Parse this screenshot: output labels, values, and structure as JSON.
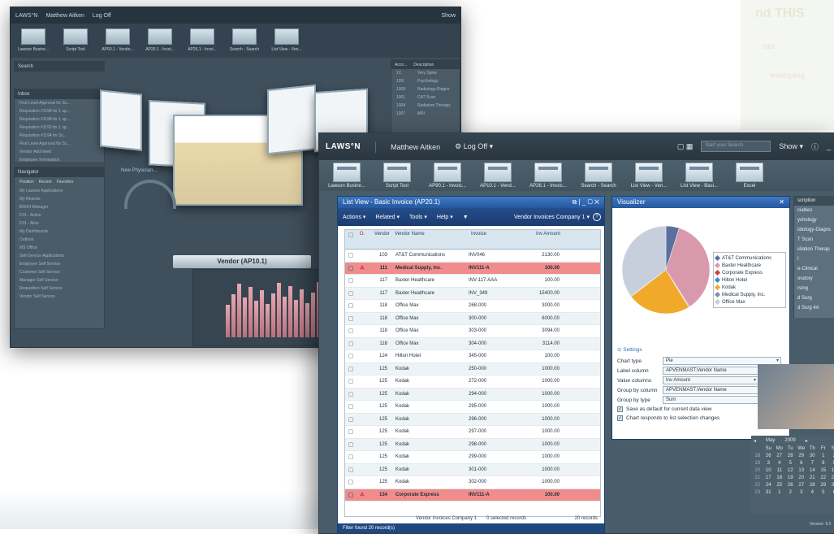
{
  "background_app": {
    "logo": "LAWS°N",
    "user": "Matthew Aitken",
    "logoff": "Log Off",
    "show": "Show",
    "thumbs": [
      "Lawson Busine...",
      "Script Tool",
      "AP90.1 - Vendo...",
      "AP20.1 - Invoi...",
      "AP26.1 - Invoi...",
      "Search - Search",
      "List View - Ven..."
    ],
    "search_header": "Search",
    "inbox_header": "Inbox",
    "inbox_items": [
      "First Level Approval for Sc...",
      "Requisition #1198 for 1 sp...",
      "Requisition #1198 for 1 sp...",
      "Requisition #1193 for 1 sp...",
      "Requisition #1194 for Sc...",
      "First Level Approval for Sc...",
      "Vendor Add Need",
      "Employee Termination"
    ],
    "navigator_header": "Navigator",
    "navigator_tabs": [
      "Position",
      "Recent",
      "Favorites"
    ],
    "navigator_items": [
      "My Lawson Applications",
      "My Reports",
      "BWJH Manager",
      "D11 - Active",
      "D11 - Alice",
      "My Dashboards",
      "Outlook",
      "MS Office",
      "Self-Service Applications",
      "Employee Self Service",
      "Customer Self Service",
      "Manager Self Service",
      "Requisition Self Service",
      "Vendor Self Service"
    ],
    "desc_columns": [
      "Acco...",
      "Description"
    ],
    "desc_rows": [
      [
        "1C",
        "Very Spine"
      ],
      [
        "1D6",
        "Psychology"
      ],
      [
        "1009",
        "Radiology-Diagns"
      ],
      [
        "1001",
        "CAT Scan"
      ],
      [
        "1004",
        "Radiation Therapy"
      ],
      [
        "1007",
        "MRI"
      ]
    ],
    "vendor_banner": "Vendor (AP10.1)",
    "gauge_label": "New Physician..."
  },
  "titlebar": {
    "logo": "LAWS°N",
    "user": "Matthew Aitken",
    "logoff": "Log Off",
    "search_placeholder": "Start your Search",
    "show": "Show"
  },
  "thumbs": [
    "Lawson Busine...",
    "Script Tool",
    "AP90.1 - Invoic...",
    "AP10.1 - Vend...",
    "AP26.1 - Invoic...",
    "Search - Search",
    "List View - Ven...",
    "List View - Basi...",
    "Excel"
  ],
  "listview": {
    "title": "List View - Basic Invoice (AP20.1)",
    "menu": [
      "Actions",
      "Related",
      "Tools",
      "Help"
    ],
    "company": "Vendor Invoices Company 1",
    "columns": [
      "Vendor",
      "Vendor Name",
      "Invoice",
      "Inv Amount"
    ],
    "rows": [
      {
        "vendor": "103",
        "name": "AT&T Communications",
        "invoice": "INV046",
        "amount": "2130.00",
        "hl": false
      },
      {
        "vendor": "111",
        "name": "Medical Supply, Inc.",
        "invoice": "INV111-A",
        "amount": "100.00",
        "hl": true
      },
      {
        "vendor": "117",
        "name": "Baxter Healthcare",
        "invoice": "INV-117-AAA",
        "amount": "100.00",
        "hl": false
      },
      {
        "vendor": "117",
        "name": "Baxter Healthcare",
        "invoice": "INV_349",
        "amount": "15400.00",
        "hl": false
      },
      {
        "vendor": "118",
        "name": "Office Max",
        "invoice": "268-000",
        "amount": "3000.00",
        "hl": false
      },
      {
        "vendor": "118",
        "name": "Office Max",
        "invoice": "300-000",
        "amount": "6000.00",
        "hl": false
      },
      {
        "vendor": "118",
        "name": "Office Max",
        "invoice": "303-000",
        "amount": "3094.00",
        "hl": false
      },
      {
        "vendor": "118",
        "name": "Office Max",
        "invoice": "304-000",
        "amount": "3114.00",
        "hl": false
      },
      {
        "vendor": "124",
        "name": "Hilton Hotel",
        "invoice": "345-000",
        "amount": "100.00",
        "hl": false
      },
      {
        "vendor": "125",
        "name": "Kodak",
        "invoice": "250-000",
        "amount": "1000.00",
        "hl": false
      },
      {
        "vendor": "125",
        "name": "Kodak",
        "invoice": "272-000",
        "amount": "1000.00",
        "hl": false
      },
      {
        "vendor": "125",
        "name": "Kodak",
        "invoice": "294-000",
        "amount": "1000.00",
        "hl": false
      },
      {
        "vendor": "125",
        "name": "Kodak",
        "invoice": "295-000",
        "amount": "1000.00",
        "hl": false
      },
      {
        "vendor": "125",
        "name": "Kodak",
        "invoice": "296-000",
        "amount": "1000.00",
        "hl": false
      },
      {
        "vendor": "125",
        "name": "Kodak",
        "invoice": "297-000",
        "amount": "1000.00",
        "hl": false
      },
      {
        "vendor": "125",
        "name": "Kodak",
        "invoice": "298-000",
        "amount": "1000.00",
        "hl": false
      },
      {
        "vendor": "125",
        "name": "Kodak",
        "invoice": "299-000",
        "amount": "1000.00",
        "hl": false
      },
      {
        "vendor": "125",
        "name": "Kodak",
        "invoice": "301-000",
        "amount": "1000.00",
        "hl": false
      },
      {
        "vendor": "125",
        "name": "Kodak",
        "invoice": "302-000",
        "amount": "1000.00",
        "hl": false
      },
      {
        "vendor": "134",
        "name": "Corporate Express",
        "invoice": "INV111-A",
        "amount": "100.00",
        "hl": true
      }
    ],
    "status_company": "Vendor Invoices Company 1",
    "status_selected": "0 selected records",
    "status_count": "20 records",
    "filter_text": "Filter found 20 record(s)"
  },
  "visualizer": {
    "title": "Visualizer",
    "legend": [
      {
        "label": "AT&T Communications",
        "color": "#5b6f9e"
      },
      {
        "label": "Baxter Healthcare",
        "color": "#d999ad"
      },
      {
        "label": "Corporate Express",
        "color": "#d43b3b"
      },
      {
        "label": "Hilton Hotel",
        "color": "#3a8bc8"
      },
      {
        "label": "Kodak",
        "color": "#f0a92a"
      },
      {
        "label": "Medical Supply, Inc.",
        "color": "#7e8fb0"
      },
      {
        "label": "Office Max",
        "color": "#c7cfdc"
      }
    ],
    "settings_label": "Settings",
    "chart_type_label": "Chart type",
    "chart_type_value": "Pie",
    "label_column_label": "Label column",
    "label_column_value": "APVENMAST.Vendor Name",
    "value_columns_label": "Value columns",
    "value_columns_value": "Inv Amount",
    "group_by_column_label": "Group by column",
    "group_by_column_value": "APVENMAST.Vendor Name",
    "group_by_type_label": "Group by type",
    "group_by_type_value": "Sum",
    "save_default_label": "Save as default for current data view",
    "responds_label": "Chart responds to list selection changes"
  },
  "chart_data": {
    "type": "pie",
    "categories": [
      "AT&T Communications",
      "Baxter Healthcare",
      "Corporate Express",
      "Hilton Hotel",
      "Kodak",
      "Medical Supply, Inc.",
      "Office Max"
    ],
    "values": [
      2130,
      15500,
      100,
      100,
      10000,
      100,
      15208
    ]
  },
  "right_panel": {
    "header": "scription",
    "lines": [
      "cialties",
      "ychology",
      "idiology-Diagns",
      "T Scan",
      "idiation Therap",
      "I",
      "e-Clinical",
      "oratory",
      "rsing",
      "d Surg",
      "d Surg 4A"
    ]
  },
  "calendar": {
    "month": "May",
    "year": "2009",
    "days": [
      "Su",
      "Mo",
      "Tu",
      "We",
      "Th",
      "Fr",
      "Sa"
    ],
    "weeks": [
      [
        "26",
        "27",
        "28",
        "29",
        "30",
        "1",
        "2"
      ],
      [
        "3",
        "4",
        "5",
        "6",
        "7",
        "8",
        "9"
      ],
      [
        "10",
        "11",
        "12",
        "13",
        "14",
        "15",
        "16"
      ],
      [
        "17",
        "18",
        "19",
        "20",
        "21",
        "22",
        "23"
      ],
      [
        "24",
        "25",
        "26",
        "27",
        "28",
        "29",
        "30"
      ],
      [
        "31",
        "1",
        "2",
        "3",
        "4",
        "5",
        "6"
      ]
    ],
    "week_numbers": [
      "18",
      "19",
      "20",
      "21",
      "22",
      "23"
    ],
    "footer": "Version: 9.0"
  },
  "corner": {
    "headline": "nd THIS",
    "sub1": "our",
    "sub2": "eveloping"
  }
}
